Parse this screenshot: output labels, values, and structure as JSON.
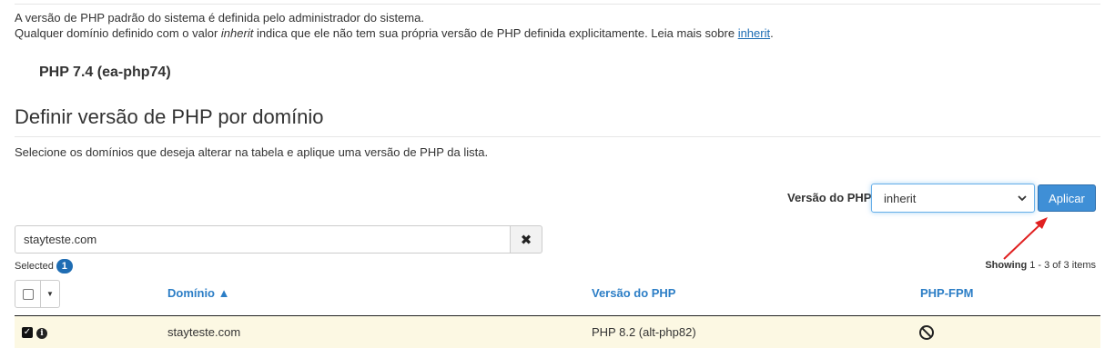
{
  "intro": {
    "line1": "A versão de PHP padrão do sistema é definida pelo administrador do sistema.",
    "line2_part1": "Qualquer domínio definido com o valor ",
    "line2_em": "inherit",
    "line2_part2": " indica que ele não tem sua própria versão de PHP definida explicitamente. Leia mais sobre ",
    "line2_link": "inherit",
    "line2_end": "."
  },
  "default_php": "PHP 7.4 (ea-php74)",
  "section": {
    "title": "Definir versão de PHP por domínio",
    "description": "Selecione os domínios que deseja alterar na tabela e aplique uma versão de PHP da lista."
  },
  "php_selector": {
    "label": "Versão do PHP",
    "selected": "inherit",
    "apply_label": "Aplicar"
  },
  "search": {
    "value": "stayteste.com",
    "clear_icon": "times-icon"
  },
  "selection": {
    "label": "Selected",
    "count": "1"
  },
  "pagination": {
    "prefix": "Showing ",
    "range": "1 - 3 of 3 items"
  },
  "table": {
    "headers": {
      "domain": "Domínio ▲",
      "version": "Versão do PHP",
      "fpm": "PHP-FPM"
    },
    "rows": [
      {
        "domain": "stayteste.com",
        "version": "PHP 8.2 (alt-php82)",
        "checked": true,
        "fpm_icon": "ban-icon"
      }
    ]
  },
  "colors": {
    "link": "#1b6bb3",
    "header": "#2c7ec6",
    "primary_button": "#3f8fd6",
    "selected_row": "#fcf8e3",
    "annotation_arrow": "#e02020"
  }
}
